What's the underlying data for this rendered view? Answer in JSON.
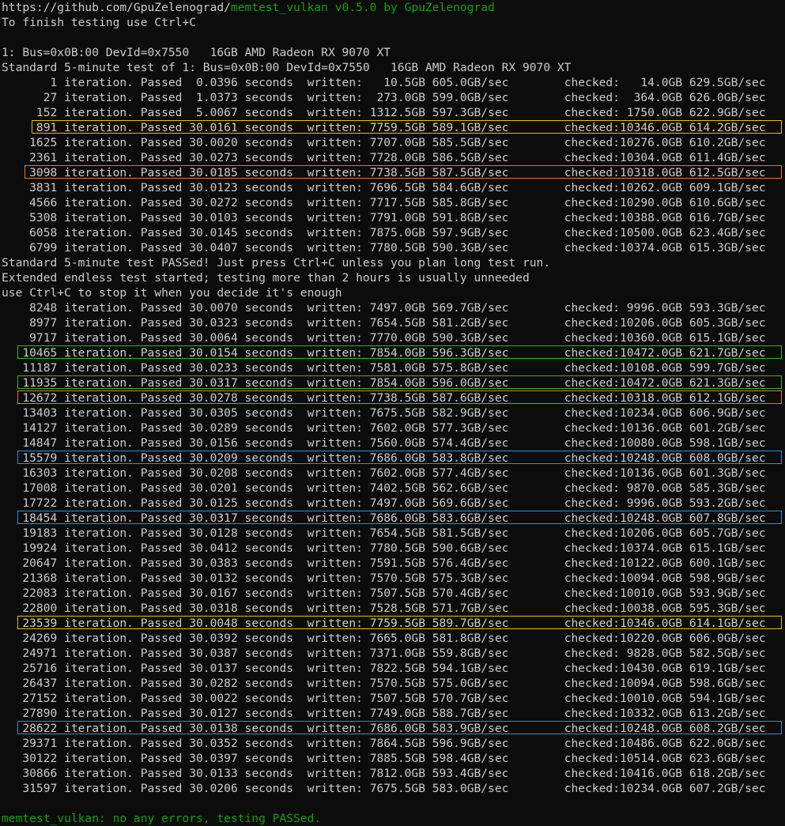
{
  "header": {
    "url_prefix": "https://github.com/GpuZelenograd/",
    "tool_name": "memtest_vulkan v0.5.0 by GpuZelenograd",
    "hint": "To finish testing use Ctrl+C"
  },
  "device_line": "1: Bus=0x0B:00 DevId=0x7550   16GB AMD Radeon RX 9070 XT",
  "standard_test_line": "Standard 5-minute test of 1: Bus=0x0B:00 DevId=0x7550   16GB AMD Radeon RX 9070 XT",
  "standard_rows": [
    {
      "iter": "1",
      "secs": "0.0396",
      "written": "  10.5GB",
      "wrate": "605.0GB/sec",
      "checked": "   14.0GB",
      "crate": "629.5GB/sec",
      "highlight": ""
    },
    {
      "iter": "27",
      "secs": "1.0373",
      "written": " 273.0GB",
      "wrate": "599.0GB/sec",
      "checked": "  364.0GB",
      "crate": "626.0GB/sec",
      "highlight": ""
    },
    {
      "iter": "152",
      "secs": "5.0067",
      "written": "1312.5GB",
      "wrate": "597.3GB/sec",
      "checked": " 1750.0GB",
      "crate": "622.9GB/sec",
      "highlight": ""
    },
    {
      "iter": "891",
      "secs": "30.0161",
      "written": "7759.5GB",
      "wrate": "589.1GB/sec",
      "checked": "10346.0GB",
      "crate": "614.2GB/sec",
      "highlight": "yellow"
    },
    {
      "iter": "1625",
      "secs": "30.0020",
      "written": "7707.0GB",
      "wrate": "585.5GB/sec",
      "checked": "10276.0GB",
      "crate": "610.2GB/sec",
      "highlight": ""
    },
    {
      "iter": "2361",
      "secs": "30.0273",
      "written": "7728.0GB",
      "wrate": "586.5GB/sec",
      "checked": "10304.0GB",
      "crate": "611.4GB/sec",
      "highlight": ""
    },
    {
      "iter": "3098",
      "secs": "30.0185",
      "written": "7738.5GB",
      "wrate": "587.5GB/sec",
      "checked": "10318.0GB",
      "crate": "612.5GB/sec",
      "highlight": "orange"
    },
    {
      "iter": "3831",
      "secs": "30.0123",
      "written": "7696.5GB",
      "wrate": "584.6GB/sec",
      "checked": "10262.0GB",
      "crate": "609.1GB/sec",
      "highlight": ""
    },
    {
      "iter": "4566",
      "secs": "30.0272",
      "written": "7717.5GB",
      "wrate": "585.8GB/sec",
      "checked": "10290.0GB",
      "crate": "610.6GB/sec",
      "highlight": ""
    },
    {
      "iter": "5308",
      "secs": "30.0103",
      "written": "7791.0GB",
      "wrate": "591.8GB/sec",
      "checked": "10388.0GB",
      "crate": "616.7GB/sec",
      "highlight": ""
    },
    {
      "iter": "6058",
      "secs": "30.0145",
      "written": "7875.0GB",
      "wrate": "597.9GB/sec",
      "checked": "10500.0GB",
      "crate": "623.4GB/sec",
      "highlight": ""
    },
    {
      "iter": "6799",
      "secs": "30.0407",
      "written": "7780.5GB",
      "wrate": "590.3GB/sec",
      "checked": "10374.0GB",
      "crate": "615.3GB/sec",
      "highlight": ""
    }
  ],
  "messages": [
    "Standard 5-minute test PASSed! Just press Ctrl+C unless you plan long test run.",
    "Extended endless test started; testing more than 2 hours is usually unneeded",
    "use Ctrl+C to stop it when you decide it's enough"
  ],
  "extended_rows": [
    {
      "iter": "8248",
      "secs": "30.0070",
      "written": "7497.0GB",
      "wrate": "569.7GB/sec",
      "checked": " 9996.0GB",
      "crate": "593.3GB/sec",
      "highlight": ""
    },
    {
      "iter": "8977",
      "secs": "30.0323",
      "written": "7654.5GB",
      "wrate": "581.2GB/sec",
      "checked": "10206.0GB",
      "crate": "605.3GB/sec",
      "highlight": ""
    },
    {
      "iter": "9717",
      "secs": "30.0064",
      "written": "7770.0GB",
      "wrate": "590.3GB/sec",
      "checked": "10360.0GB",
      "crate": "615.1GB/sec",
      "highlight": ""
    },
    {
      "iter": "10465",
      "secs": "30.0154",
      "written": "7854.0GB",
      "wrate": "596.3GB/sec",
      "checked": "10472.0GB",
      "crate": "621.7GB/sec",
      "highlight": "green"
    },
    {
      "iter": "11187",
      "secs": "30.0233",
      "written": "7581.0GB",
      "wrate": "575.8GB/sec",
      "checked": "10108.0GB",
      "crate": "599.7GB/sec",
      "highlight": ""
    },
    {
      "iter": "11935",
      "secs": "30.0317",
      "written": "7854.0GB",
      "wrate": "596.0GB/sec",
      "checked": "10472.0GB",
      "crate": "621.3GB/sec",
      "highlight": "green"
    },
    {
      "iter": "12672",
      "secs": "30.0278",
      "written": "7738.5GB",
      "wrate": "587.6GB/sec",
      "checked": "10318.0GB",
      "crate": "612.1GB/sec",
      "highlight": "orange"
    },
    {
      "iter": "13403",
      "secs": "30.0305",
      "written": "7675.5GB",
      "wrate": "582.9GB/sec",
      "checked": "10234.0GB",
      "crate": "606.9GB/sec",
      "highlight": ""
    },
    {
      "iter": "14127",
      "secs": "30.0289",
      "written": "7602.0GB",
      "wrate": "577.3GB/sec",
      "checked": "10136.0GB",
      "crate": "601.2GB/sec",
      "highlight": ""
    },
    {
      "iter": "14847",
      "secs": "30.0156",
      "written": "7560.0GB",
      "wrate": "574.4GB/sec",
      "checked": "10080.0GB",
      "crate": "598.1GB/sec",
      "highlight": ""
    },
    {
      "iter": "15579",
      "secs": "30.0209",
      "written": "7686.0GB",
      "wrate": "583.8GB/sec",
      "checked": "10248.0GB",
      "crate": "608.0GB/sec",
      "highlight": "blue"
    },
    {
      "iter": "16303",
      "secs": "30.0208",
      "written": "7602.0GB",
      "wrate": "577.4GB/sec",
      "checked": "10136.0GB",
      "crate": "601.3GB/sec",
      "highlight": ""
    },
    {
      "iter": "17008",
      "secs": "30.0201",
      "written": "7402.5GB",
      "wrate": "562.6GB/sec",
      "checked": " 9870.0GB",
      "crate": "585.3GB/sec",
      "highlight": ""
    },
    {
      "iter": "17722",
      "secs": "30.0125",
      "written": "7497.0GB",
      "wrate": "569.6GB/sec",
      "checked": " 9996.0GB",
      "crate": "593.2GB/sec",
      "highlight": ""
    },
    {
      "iter": "18454",
      "secs": "30.0317",
      "written": "7686.0GB",
      "wrate": "583.6GB/sec",
      "checked": "10248.0GB",
      "crate": "607.8GB/sec",
      "highlight": "blue"
    },
    {
      "iter": "19183",
      "secs": "30.0128",
      "written": "7654.5GB",
      "wrate": "581.5GB/sec",
      "checked": "10206.0GB",
      "crate": "605.7GB/sec",
      "highlight": ""
    },
    {
      "iter": "19924",
      "secs": "30.0412",
      "written": "7780.5GB",
      "wrate": "590.6GB/sec",
      "checked": "10374.0GB",
      "crate": "615.1GB/sec",
      "highlight": ""
    },
    {
      "iter": "20647",
      "secs": "30.0383",
      "written": "7591.5GB",
      "wrate": "576.4GB/sec",
      "checked": "10122.0GB",
      "crate": "600.1GB/sec",
      "highlight": ""
    },
    {
      "iter": "21368",
      "secs": "30.0132",
      "written": "7570.5GB",
      "wrate": "575.3GB/sec",
      "checked": "10094.0GB",
      "crate": "598.9GB/sec",
      "highlight": ""
    },
    {
      "iter": "22083",
      "secs": "30.0167",
      "written": "7507.5GB",
      "wrate": "570.4GB/sec",
      "checked": "10010.0GB",
      "crate": "593.9GB/sec",
      "highlight": ""
    },
    {
      "iter": "22800",
      "secs": "30.0318",
      "written": "7528.5GB",
      "wrate": "571.7GB/sec",
      "checked": "10038.0GB",
      "crate": "595.3GB/sec",
      "highlight": ""
    },
    {
      "iter": "23539",
      "secs": "30.0048",
      "written": "7759.5GB",
      "wrate": "589.7GB/sec",
      "checked": "10346.0GB",
      "crate": "614.1GB/sec",
      "highlight": "yellow"
    },
    {
      "iter": "24269",
      "secs": "30.0392",
      "written": "7665.0GB",
      "wrate": "581.8GB/sec",
      "checked": "10220.0GB",
      "crate": "606.0GB/sec",
      "highlight": ""
    },
    {
      "iter": "24971",
      "secs": "30.0387",
      "written": "7371.0GB",
      "wrate": "559.8GB/sec",
      "checked": " 9828.0GB",
      "crate": "582.5GB/sec",
      "highlight": ""
    },
    {
      "iter": "25716",
      "secs": "30.0137",
      "written": "7822.5GB",
      "wrate": "594.1GB/sec",
      "checked": "10430.0GB",
      "crate": "619.1GB/sec",
      "highlight": ""
    },
    {
      "iter": "26437",
      "secs": "30.0282",
      "written": "7570.5GB",
      "wrate": "575.0GB/sec",
      "checked": "10094.0GB",
      "crate": "598.6GB/sec",
      "highlight": ""
    },
    {
      "iter": "27152",
      "secs": "30.0022",
      "written": "7507.5GB",
      "wrate": "570.7GB/sec",
      "checked": "10010.0GB",
      "crate": "594.1GB/sec",
      "highlight": ""
    },
    {
      "iter": "27890",
      "secs": "30.0127",
      "written": "7749.0GB",
      "wrate": "588.7GB/sec",
      "checked": "10332.0GB",
      "crate": "613.2GB/sec",
      "highlight": ""
    },
    {
      "iter": "28622",
      "secs": "30.0138",
      "written": "7686.0GB",
      "wrate": "583.9GB/sec",
      "checked": "10248.0GB",
      "crate": "608.2GB/sec",
      "highlight": "blue"
    },
    {
      "iter": "29371",
      "secs": "30.0352",
      "written": "7864.5GB",
      "wrate": "596.9GB/sec",
      "checked": "10486.0GB",
      "crate": "622.0GB/sec",
      "highlight": ""
    },
    {
      "iter": "30122",
      "secs": "30.0397",
      "written": "7885.5GB",
      "wrate": "598.4GB/sec",
      "checked": "10514.0GB",
      "crate": "623.6GB/sec",
      "highlight": ""
    },
    {
      "iter": "30866",
      "secs": "30.0133",
      "written": "7812.0GB",
      "wrate": "593.4GB/sec",
      "checked": "10416.0GB",
      "crate": "618.2GB/sec",
      "highlight": ""
    },
    {
      "iter": "31597",
      "secs": "30.0206",
      "written": "7675.5GB",
      "wrate": "583.0GB/sec",
      "checked": "10234.0GB",
      "crate": "607.2GB/sec",
      "highlight": ""
    }
  ],
  "final_message": "memtest_vulkan: no any errors, testing PASSed.",
  "labels": {
    "iteration": " iteration. Passed ",
    "seconds": " seconds  written:",
    "checked": "checked:"
  },
  "colors": {
    "background": "#0c0c0c",
    "text": "#cccccc",
    "green": "#13a10e",
    "highlight_yellow": "#e5c100",
    "highlight_orange": "#e0763a",
    "highlight_green": "#2fb53a",
    "highlight_blue": "#2b8fd8"
  }
}
